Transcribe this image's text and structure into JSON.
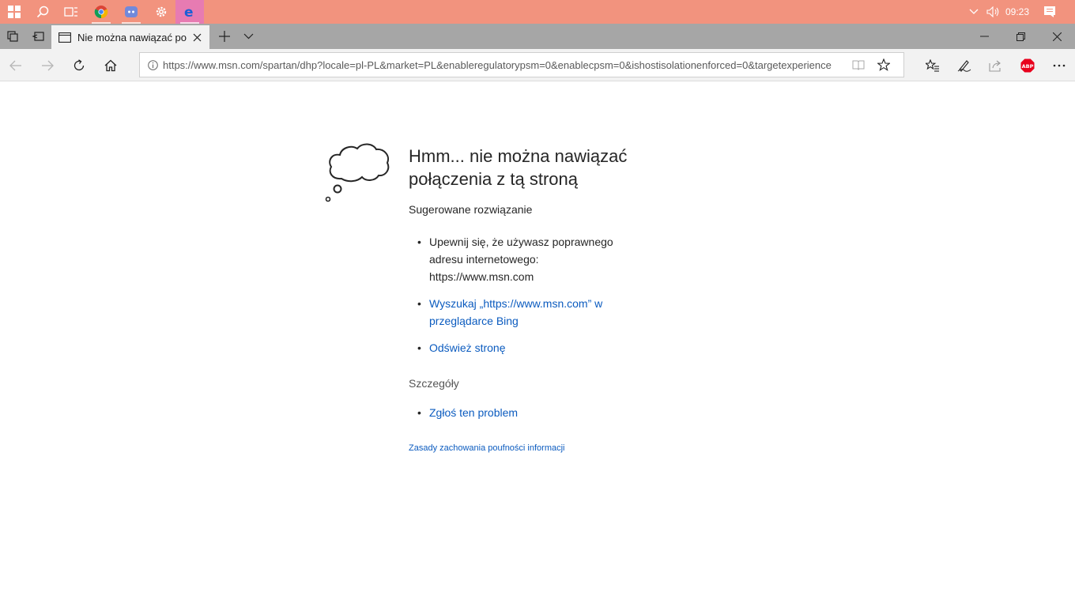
{
  "taskbar": {
    "icons": [
      "windows-start-icon",
      "search-icon",
      "task-view-icon",
      "chrome-icon",
      "discord-icon",
      "settings-icon",
      "edge-icon"
    ],
    "clock": "09:23"
  },
  "tab": {
    "title": "Nie można nawiązać po"
  },
  "address": {
    "url": "https://www.msn.com/spartan/dhp?locale=pl-PL&market=PL&enableregulatorypsm=0&enablecpsm=0&ishostisolationenforced=0&targetexperience"
  },
  "page": {
    "heading_line1": "Hmm... nie można nawiązać",
    "heading_line2": "połączenia z tą stroną",
    "suggested": "Sugerowane rozwiązanie",
    "item1_line1": "Upewnij się, że używasz poprawnego",
    "item1_line2": "adresu internetowego:",
    "item1_line3": "https://www.msn.com",
    "item2_line1": "Wyszukaj „https://www.msn.com” w",
    "item2_line2": "przeglądarce Bing",
    "item3": "Odśwież stronę",
    "details": "Szczegóły",
    "report": "Zgłoś ten problem",
    "privacy": "Zasady zachowania poufności informacji"
  },
  "colors": {
    "taskbar": "#f2937e",
    "link": "#0b5bbf",
    "abp": "#e8001c"
  }
}
